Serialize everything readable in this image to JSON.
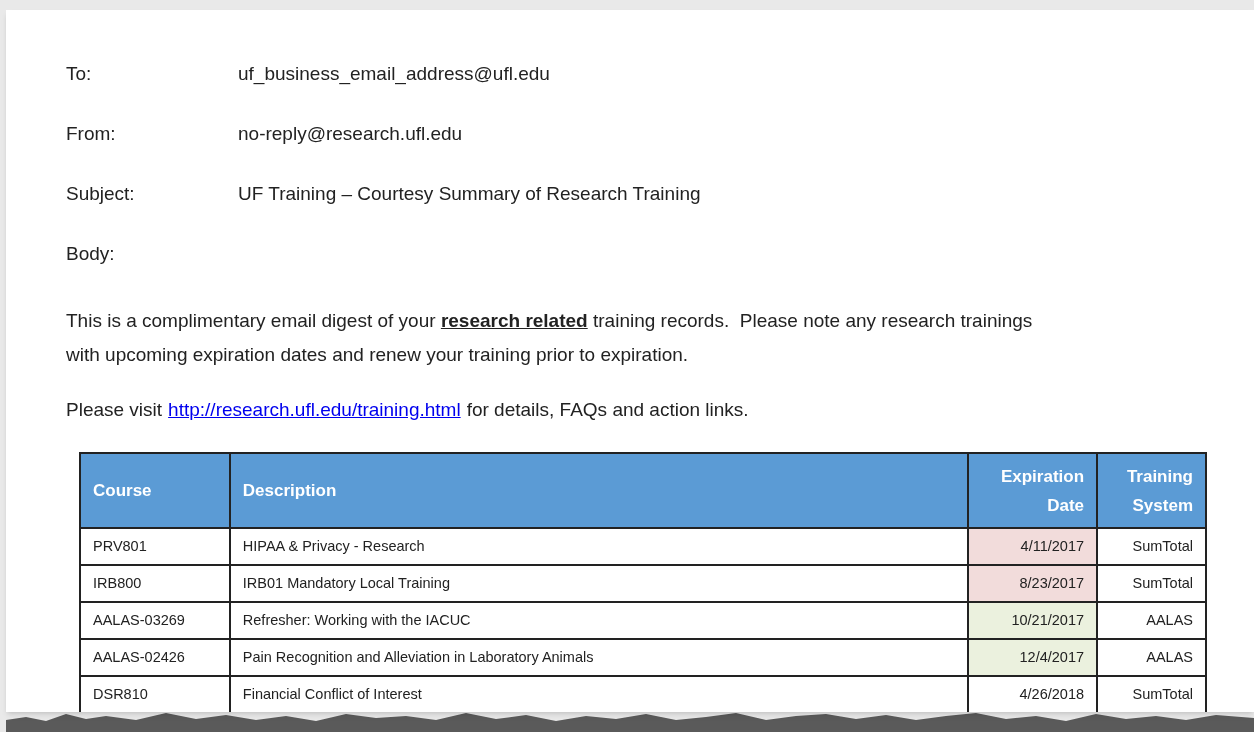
{
  "header_fields": [
    {
      "label": "To:",
      "value": "uf_business_email_address@ufl.edu"
    },
    {
      "label": "From:",
      "value": "no-reply@research.ufl.edu"
    },
    {
      "label": "Subject:",
      "value": "UF Training – Courtesy Summary of Research Training"
    },
    {
      "label": "Body:"
    }
  ],
  "body": {
    "paragraph": "This is a complimentary email digest of your **research related** training records.  Please note any research trainings with upcoming expiration dates and renew your training prior to expiration.",
    "visit_before": "Please visit",
    "link": "http://research.ufl.edu/training.html",
    "visit_after": "for details, FAQs and action links."
  },
  "table": {
    "columns": [
      "Course",
      "Description",
      "Expiration Date",
      "Training System"
    ],
    "rows": [
      {
        "course": "PRV801",
        "description": "HIPAA & Privacy - Research",
        "expiration": "4/11/2017",
        "system": "SumTotal",
        "color": "#f2dcdb"
      },
      {
        "course": "IRB800",
        "description": "IRB01 Mandatory Local Training",
        "expiration": "8/23/2017",
        "system": "SumTotal",
        "color": "#f2dcdb"
      },
      {
        "course": "AALAS-03269",
        "description": "Refresher:  Working with the IACUC",
        "expiration": "10/21/2017",
        "system": "AALAS",
        "color": "#ebf1de"
      },
      {
        "course": "AALAS-02426",
        "description": "Pain Recognition and Alleviation in Laboratory Animals",
        "expiration": "12/4/2017",
        "system": "AALAS",
        "color": "#ebf1de"
      },
      {
        "course": "DSR810",
        "description": "Financial Conflict of Interest",
        "expiration": "4/26/2018",
        "system": "SumTotal"
      }
    ]
  }
}
